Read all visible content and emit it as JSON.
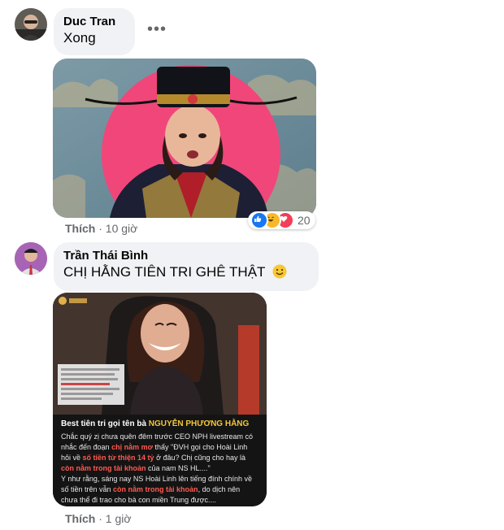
{
  "comments": [
    {
      "author": "Duc Tran",
      "text": "Xong",
      "more_icon": "more-horizontal-icon",
      "like_label": "Thích",
      "timestamp": "10 giờ",
      "reactions": {
        "icons": [
          "like-icon",
          "haha-icon",
          "love-icon"
        ],
        "count": "20"
      }
    },
    {
      "author": "Trần Thái Bình",
      "text": "CHỊ HẰNG TIÊN TRI GHÊ THẬT",
      "emoji": "smile-emoji-icon",
      "like_label": "Thích",
      "timestamp": "1 giờ",
      "image": {
        "headline_white": "Best tiên tri gọi tên bà ",
        "headline_gold": "NGUYỄN PHƯƠNG HẰNG",
        "body": [
          {
            "t": "Chắc quý zị chưa quên đêm trước CEO NPH livestream có nhắc đến đoạn ",
            "c": ""
          },
          {
            "t": "chị nằm mơ",
            "c": "red"
          },
          {
            "t": " thấy \"ĐVH gọi cho Hoài Linh hỏi về ",
            "c": ""
          },
          {
            "t": "số tiền từ thiện 14 tỷ",
            "c": "red"
          },
          {
            "t": " ở đâu? Chị cũng cho hay là ",
            "c": ""
          },
          {
            "t": "còn nằm trong tài khoản",
            "c": "red"
          },
          {
            "t": " của nam NS HL....\" ",
            "c": ""
          },
          {
            "t": "Y như rằng, sáng nay NS Hoài Linh lên tiếng đính chính về số tiền trên vẫn ",
            "c": ""
          },
          {
            "t": "còn nằm trong tài khoản",
            "c": "red"
          },
          {
            "t": ", do dịch nên chưa thể đi trao cho bà con miền Trung được....",
            "c": ""
          }
        ]
      }
    }
  ],
  "colors": {
    "bubble_bg": "#f0f2f5",
    "meta_text": "#65676b",
    "like_blue": "#1877f2",
    "haha_yellow": "#f7b928",
    "love_red": "#f33e58"
  }
}
